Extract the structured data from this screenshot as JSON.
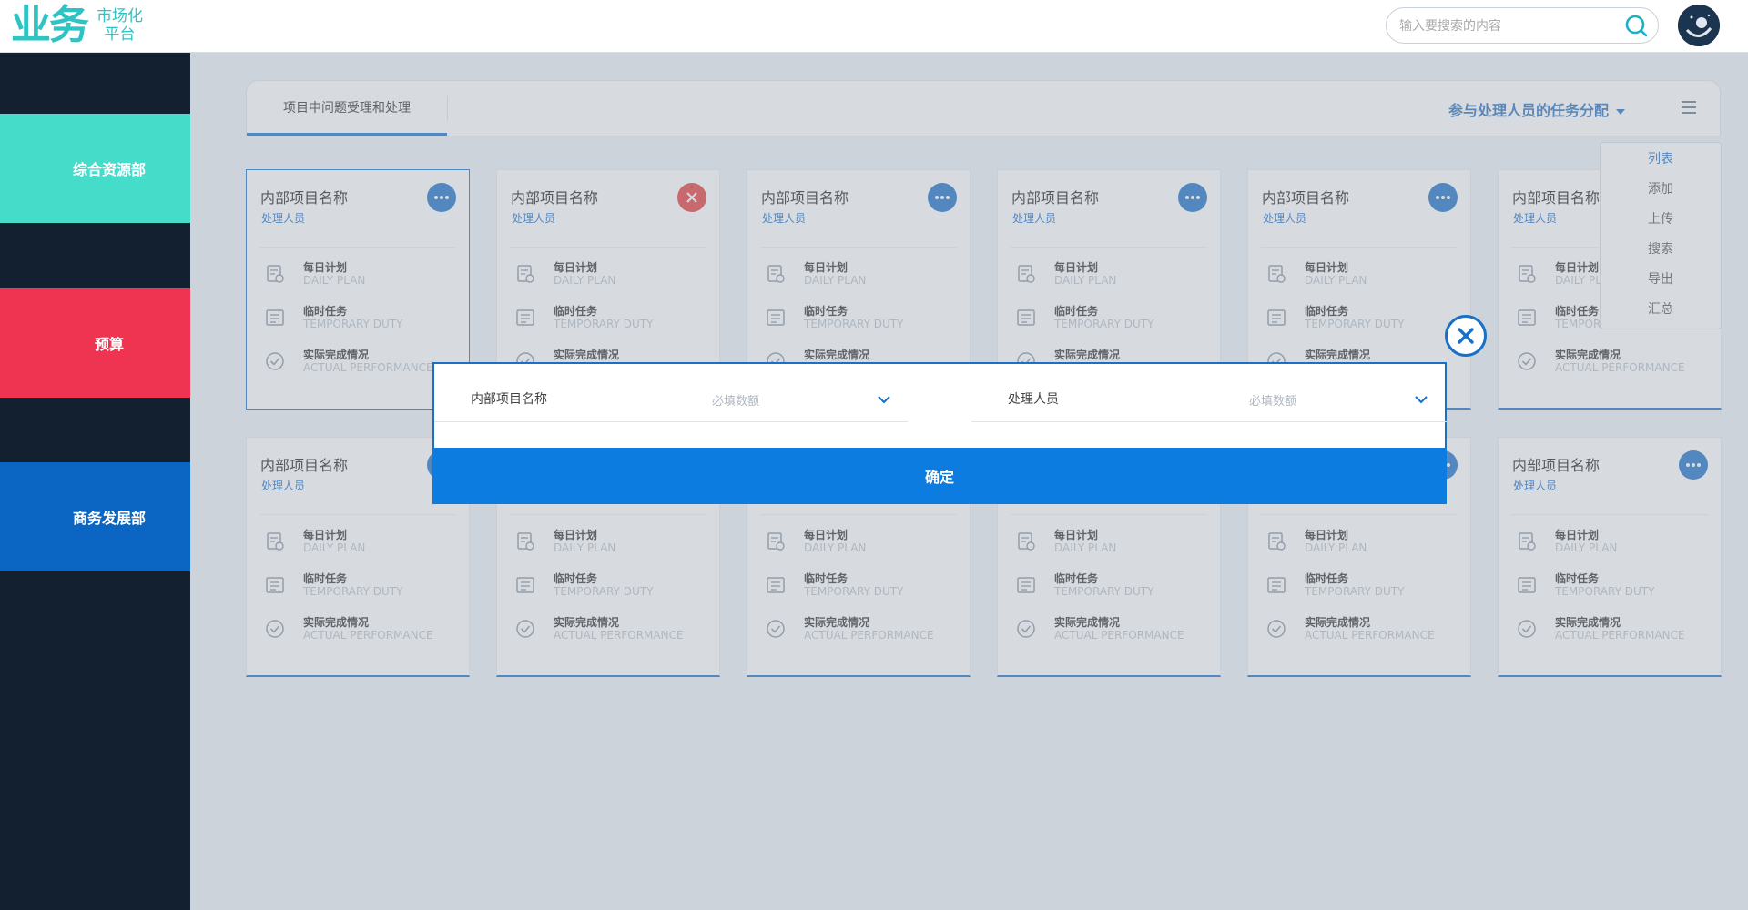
{
  "logo": {
    "main": "业务",
    "sub_line1": "市场化",
    "sub_line2": "平台"
  },
  "search": {
    "placeholder": "输入要搜索的内容"
  },
  "sidebar": {
    "items": [
      {
        "label": "综合资源部",
        "color": "#45dcc9"
      },
      {
        "label": "预算",
        "color": "#ef3452"
      },
      {
        "label": "商务发展部",
        "color": "#0a66c2"
      }
    ]
  },
  "tabs": {
    "active_label": "项目中问题受理和处理"
  },
  "header": {
    "assign_label": "参与处理人员的任务分配"
  },
  "dropdown": {
    "items": [
      "列表",
      "添加",
      "上传",
      "搜索",
      "导出",
      "汇总"
    ],
    "active_index": 0
  },
  "card_template": {
    "title": "内部项目名称",
    "subtitle": "处理人员",
    "rows": [
      {
        "cn": "每日计划",
        "en": "DAILY PLAN",
        "icon": "daily-plan-icon"
      },
      {
        "cn": "临时任务",
        "en": "TEMPORARY DUTY",
        "icon": "temporary-duty-icon"
      },
      {
        "cn": "实际完成情况",
        "en": "ACTUAL PERFORMANCE",
        "icon": "actual-performance-icon"
      }
    ]
  },
  "cards": {
    "rows": 2,
    "per_row": 6,
    "delete_card_index": 1
  },
  "modal": {
    "field1": {
      "label": "内部项目名称",
      "placeholder": "必填数额"
    },
    "field2": {
      "label": "处理人员",
      "placeholder": "必填数额"
    },
    "confirm_label": "确定"
  },
  "colors": {
    "accent": "#1a6fc6",
    "confirm": "#0d7ce0",
    "teal": "#2ec4c4",
    "sidebar_bg": "#13202f",
    "delete": "#e53b3b"
  }
}
